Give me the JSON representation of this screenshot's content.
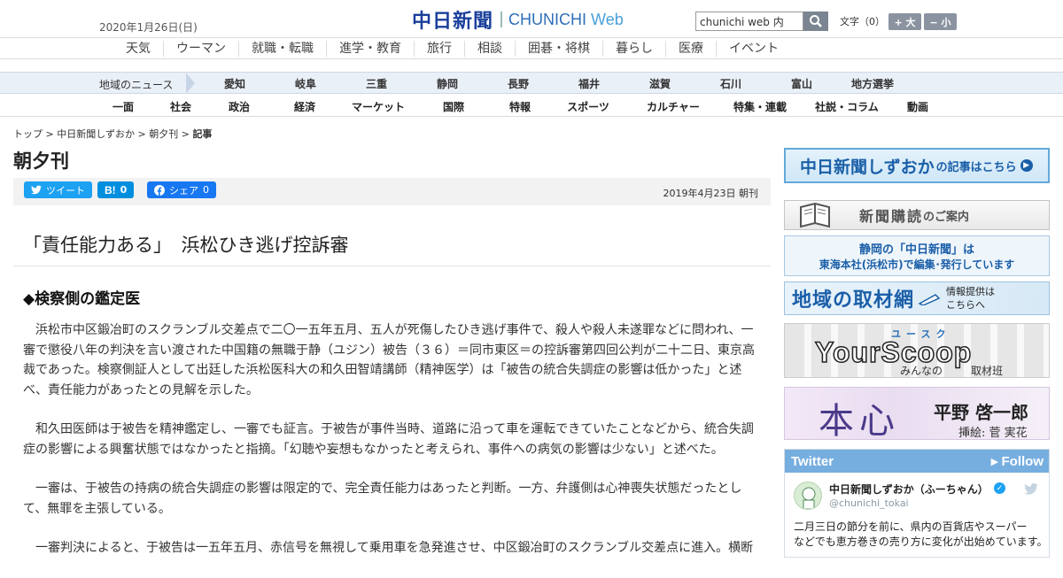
{
  "header": {
    "date": "2020年1月26日(日)",
    "logo_jp": "中日新聞",
    "logo_en_a": "CHUNICHI",
    "logo_en_b": "Web",
    "search_value": "chunichi web 内",
    "fontsize_label": "文字（0）",
    "font_up": "+ 大",
    "font_down": "− 小"
  },
  "subnav": [
    "天気",
    "ウーマン",
    "就職・転職",
    "進学・教育",
    "旅行",
    "相談",
    "囲碁・将棋",
    "暮らし",
    "医療",
    "イベント"
  ],
  "region": {
    "label": "地域のニュース",
    "items": [
      "愛知",
      "岐阜",
      "三重",
      "静岡",
      "長野",
      "福井",
      "滋賀",
      "石川",
      "富山",
      "地方選挙"
    ]
  },
  "mainnav": [
    "一面",
    "社会",
    "政治",
    "経済",
    "マーケット",
    "国際",
    "特報",
    "スポーツ",
    "カルチャー",
    "特集・連載",
    "社説・コラム",
    "動画"
  ],
  "breadcrumb": {
    "top": "トップ",
    "site": "中日新聞しずおか",
    "section": "朝夕刊",
    "current": "記事",
    "sep": " > "
  },
  "section_title": "朝夕刊",
  "share": {
    "tweet": "ツイート",
    "hatena_count": "0",
    "fb_label": "シェア",
    "fb_count": "0"
  },
  "article": {
    "published": "2019年4月23日 朝刊",
    "headline": "「責任能力ある」　浜松ひき逃げ控訴審",
    "subhead": "◆検察側の鑑定医",
    "paragraphs": [
      "浜松市中区鍛冶町のスクランブル交差点で二〇一五年五月、五人が死傷したひき逃げ事件で、殺人や殺人未遂罪などに問われ、一審で懲役八年の判決を言い渡された中国籍の無職于静（ユジン）被告（３６）＝同市東区＝の控訴審第四回公判が二十二日、東京高裁であった。検察側証人として出廷した浜松医科大の和久田智靖講師（精神医学）は「被告の統合失調症の影響は低かった」と述べ、責任能力があったとの見解を示した。",
      "和久田医師は于被告を精神鑑定し、一審でも証言。于被告が事件当時、道路に沿って車を運転できていたことなどから、統合失調症の影響による興奮状態ではなかったと指摘。「幻聴や妄想もなかったと考えられ、事件への病気の影響は少ない」と述べた。",
      "一審は、于被告の持病の統合失調症の影響は限定的で、完全責任能力はあったと判断。一方、弁護側は心神喪失状態だったとして、無罪を主張している。",
      "一審判決によると、于被告は一五年五月、赤信号を無視して乗用車を急発進させ、中区鍛冶町のスクランブル交差点に進入。横断"
    ]
  },
  "sidebar": {
    "b1_main": "中日新聞しずおか",
    "b1_sub": "の記事はこちら",
    "b2_main": "新聞購読",
    "b2_sub": "のご案内",
    "b3_line1": "静岡の「中日新聞」は",
    "b3_line2": "東海本社(浜松市)で編集･発行しています",
    "b4_main": "地域の取材網",
    "b4_sub1": "情報提供は",
    "b4_sub2": "こちらへ",
    "b5_top": "ユースク",
    "b5_main": "YourScoop",
    "b5_sub": "みんなの",
    "b5_sub2": "取材班",
    "b6_main": "本心",
    "b6_author": "平野 啓一郎",
    "b6_illus": "挿絵: 菅 実花"
  },
  "twitter": {
    "label": "Twitter",
    "follow": "▸ Follow",
    "account_name": "中日新聞しずおか（ふーちゃん）",
    "handle": "@chunichi_tokai",
    "tweet_line1": "二月三日の節分を前に、県内の百貨店やスーパー",
    "tweet_line2": "などでも恵方巻きの売り方に変化が出始めています。"
  },
  "colors": {
    "twitter_blue": "#1da1f2",
    "hatena_blue": "#008fde",
    "facebook_blue": "#1877f2",
    "logo_navy": "#1a3f9b"
  }
}
